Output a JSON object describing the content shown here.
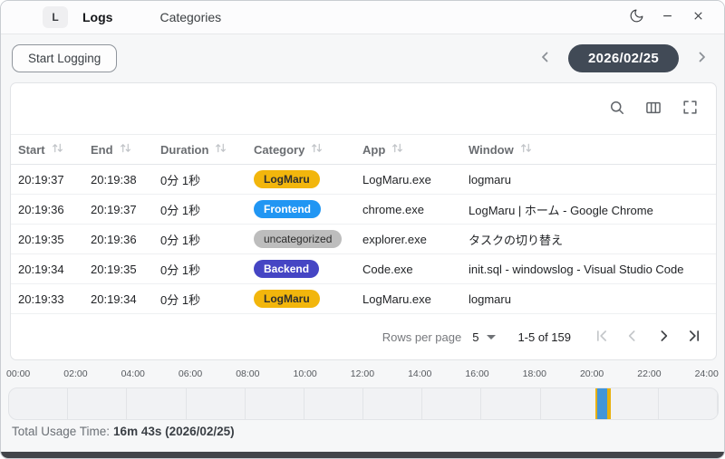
{
  "titlebar": {
    "app_initial": "L",
    "tabs": [
      {
        "label": "Logs"
      },
      {
        "label": "Categories"
      }
    ]
  },
  "controls": {
    "start_logging": "Start Logging",
    "date": "2026/02/25"
  },
  "datagrid": {
    "columns": [
      {
        "label": "Start"
      },
      {
        "label": "End"
      },
      {
        "label": "Duration"
      },
      {
        "label": "Category"
      },
      {
        "label": "App"
      },
      {
        "label": "Window"
      }
    ],
    "rows": [
      {
        "start": "20:19:37",
        "end": "20:19:38",
        "duration": "0分 1秒",
        "category": "LogMaru",
        "category_bg": "#F2B60C",
        "category_fg": "#2e2e2e",
        "app": "LogMaru.exe",
        "window": "logmaru"
      },
      {
        "start": "20:19:36",
        "end": "20:19:37",
        "duration": "0分 1秒",
        "category": "Frontend",
        "category_bg": "#2196F3",
        "category_fg": "#ffffff",
        "app": "chrome.exe",
        "window": "LogMaru | ホーム - Google Chrome"
      },
      {
        "start": "20:19:35",
        "end": "20:19:36",
        "duration": "0分 1秒",
        "category": "uncategorized",
        "category_bg": "#BDBDBD",
        "category_fg": "#2b2b2b",
        "app": "explorer.exe",
        "window": "タスクの切り替え"
      },
      {
        "start": "20:19:34",
        "end": "20:19:35",
        "duration": "0分 1秒",
        "category": "Backend",
        "category_bg": "#4545C4",
        "category_fg": "#ffffff",
        "app": "Code.exe",
        "window": "init.sql - windowslog - Visual Studio Code"
      },
      {
        "start": "20:19:33",
        "end": "20:19:34",
        "duration": "0分 1秒",
        "category": "LogMaru",
        "category_bg": "#F2B60C",
        "category_fg": "#2e2e2e",
        "app": "LogMaru.exe",
        "window": "logmaru"
      }
    ],
    "pagination": {
      "rows_per_page_label": "Rows per page",
      "page_size": "5",
      "range": "1-5 of 159"
    }
  },
  "timeline": {
    "hour_labels": [
      "00:00",
      "02:00",
      "04:00",
      "06:00",
      "08:00",
      "10:00",
      "12:00",
      "14:00",
      "16:00",
      "18:00",
      "20:00",
      "22:00",
      "24:00"
    ],
    "segments": [
      {
        "color": "#E8B00D",
        "left": "82.70%",
        "width": "0.32%"
      },
      {
        "color": "#4295D9",
        "left": "83.02%",
        "width": "1.35%"
      },
      {
        "color": "#E8B00D",
        "left": "84.37%",
        "width": "0.60%"
      }
    ]
  },
  "summary": {
    "label": "Total Usage Time:",
    "value": "16m 43s (2026/02/25)"
  }
}
